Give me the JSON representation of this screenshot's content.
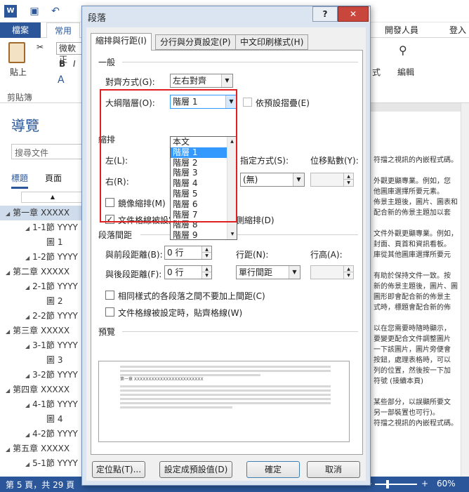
{
  "word": {
    "logo": "W",
    "tab_file": "檔案",
    "tab_home": "常用",
    "tab_developer": "開發人員",
    "sign_in": "登入",
    "paste": "貼上",
    "clipboard": "剪貼簿",
    "font": "微軟正",
    "edit": "編輯",
    "style": "式"
  },
  "nav": {
    "title": "導覽",
    "search_placeholder": "搜尋文件",
    "tab_headings": "標題",
    "tab_pages": "頁面",
    "items": [
      {
        "text": "第一章 XXXXX",
        "level": 1,
        "selected": true
      },
      {
        "text": "1-1節 YYYY",
        "level": 2
      },
      {
        "text": "圖 1",
        "level": 3
      },
      {
        "text": "1-2節 YYYY",
        "level": 2
      },
      {
        "text": "第二章 XXXXX",
        "level": 1
      },
      {
        "text": "2-1節 YYYY",
        "level": 2
      },
      {
        "text": "圖 2",
        "level": 3
      },
      {
        "text": "2-2節 YYYY",
        "level": 2
      },
      {
        "text": "第三章 XXXXX",
        "level": 1
      },
      {
        "text": "3-1節 YYYY",
        "level": 2
      },
      {
        "text": "圖 3",
        "level": 3
      },
      {
        "text": "3-2節 YYYY",
        "level": 2
      },
      {
        "text": "第四章 XXXXX",
        "level": 1
      },
      {
        "text": "4-1節 YYYY",
        "level": 2
      },
      {
        "text": "圖 4",
        "level": 3
      },
      {
        "text": "4-2節 YYYY",
        "level": 2
      },
      {
        "text": "第五章 XXXXX",
        "level": 1
      },
      {
        "text": "5-1節 YYYY",
        "level": 2
      }
    ]
  },
  "document": {
    "lines": [
      "符擋之視訊的內嵌程式碼。",
      "",
      "外觀更顯專業。例如，您",
      "他圖庫選擇所要元素。",
      "佈景主題後，圖片、圖表和",
      "配合新的佈景主題加以套",
      "",
      "文件外觀更顯專業。例如，",
      "封面、頁首和資訊看板。",
      "庫從其他圖庫選擇所要元",
      "",
      "有助於保持文件一致。按",
      "新的佈景主題後，圖片、圖",
      "圖形即會配合新的佈景主",
      "式時，標題會配合新的佈",
      "",
      "以在您需要時隨時顯示，",
      "要變更配合文件調整圖片",
      "一下該圖片，圖片旁便會",
      "按鈕，處理表格時，可以",
      "列的位置，然後按一下加",
      "符號 (接續本頁)",
      "",
      "某些部分，以誤顯所要文",
      "另一部裝置也可行)。",
      "符擋之視訊的內嵌程式碼。"
    ]
  },
  "status": {
    "page": "第 5 頁，共 29 頁",
    "zoom": "60%"
  },
  "dialog": {
    "title": "段落",
    "help": "?",
    "close": "✕",
    "tabs": [
      "縮排與行距(I)",
      "分行與分頁設定(P)",
      "中文印刷樣式(H)"
    ],
    "general": {
      "section": "一般",
      "alignment_label": "對齊方式(G):",
      "alignment_value": "左右對齊",
      "outline_label": "大綱階層(O):",
      "outline_value": "階層 1",
      "collapse_label": "依預設摺疊(E)",
      "outline_options": [
        "本文",
        "階層 1",
        "階層 2",
        "階層 3",
        "階層 4",
        "階層 5",
        "階層 6",
        "階層 7",
        "階層 8",
        "階層 9"
      ],
      "outline_selected": 1
    },
    "indent": {
      "section": "縮排",
      "left_label": "左(L):",
      "right_label": "右(R):",
      "special_label": "指定方式(S):",
      "special_value": "(無)",
      "by_label": "位移點數(Y):",
      "mirror_label": "鏡像縮排(M)",
      "mirror_checked": false,
      "autoadjust_label": "文件格線被設定時，自動調整右側縮排(D)",
      "autoadjust_checked": true
    },
    "spacing": {
      "section": "段落間距",
      "before_label": "與前段距離(B):",
      "before_value": "0 行",
      "after_label": "與後段距離(F):",
      "after_value": "0 行",
      "line_label": "行距(N):",
      "line_value": "單行間距",
      "at_label": "行高(A):",
      "nospace_label": "相同樣式的各段落之間不要加上間距(C)",
      "nospace_checked": false,
      "snap_label": "文件格線被設定時，貼齊格線(W)",
      "snap_checked": false
    },
    "preview": {
      "section": "預覽",
      "sample": "第一章 XXXXXXXXXXXXXXXXXXXXXXXX"
    },
    "buttons": {
      "tabs": "定位點(T)...",
      "default": "設定成預設值(D)",
      "ok": "確定",
      "cancel": "取消"
    }
  }
}
